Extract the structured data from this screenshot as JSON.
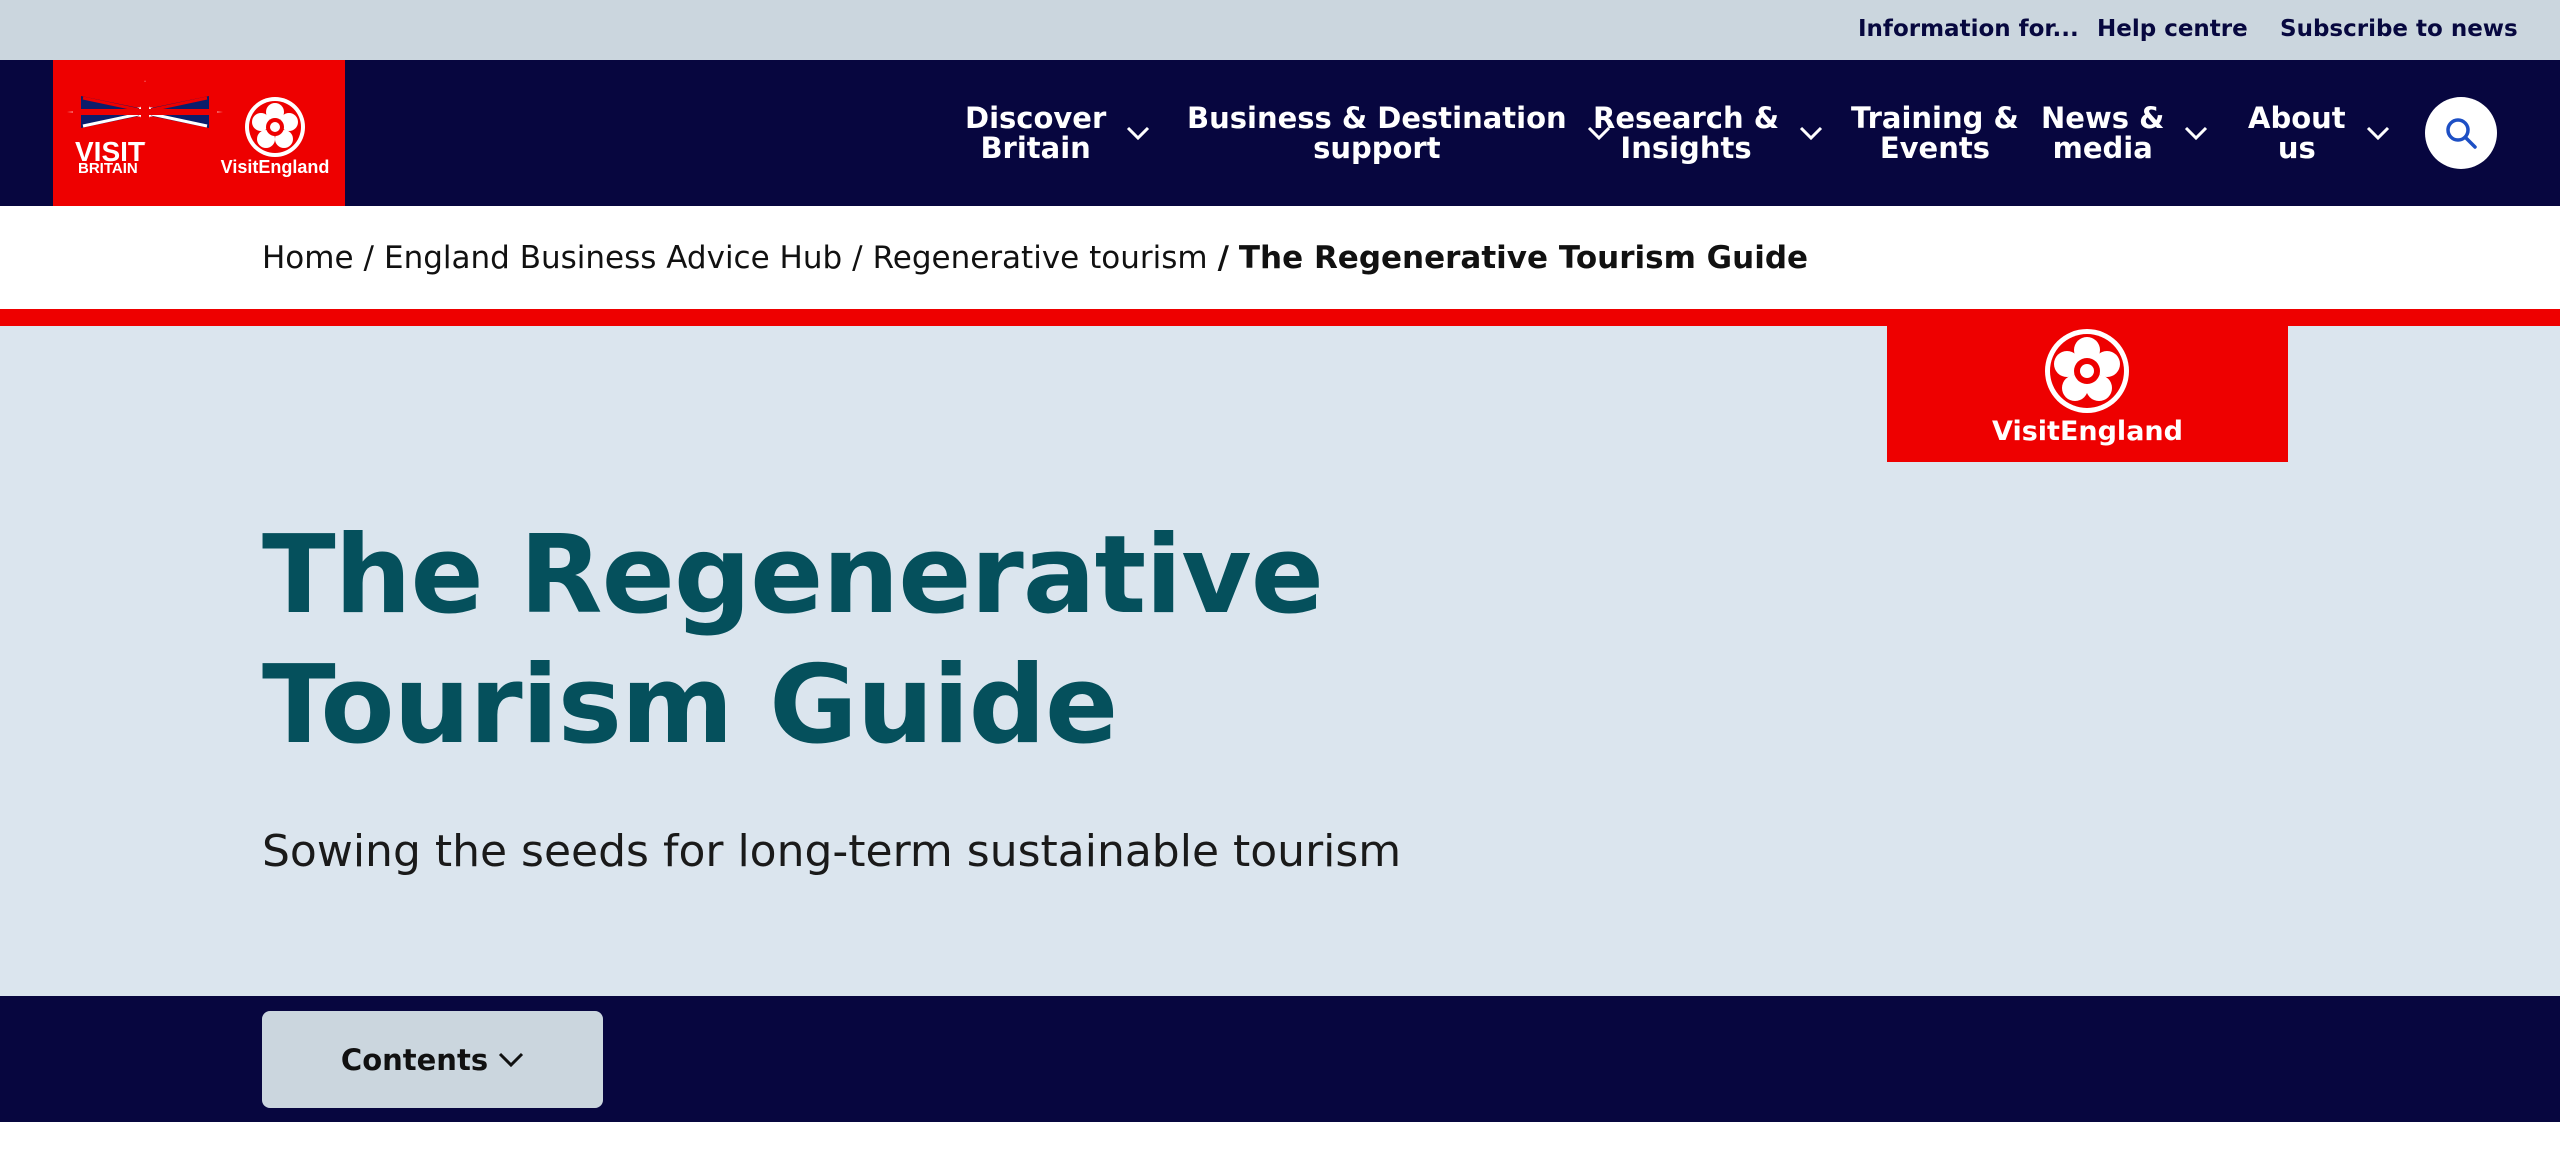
{
  "utility_links": [
    {
      "label": "Information for..."
    },
    {
      "label": "Help centre"
    },
    {
      "label": "Subscribe to news"
    }
  ],
  "logo": {
    "visit_label": "VISIT",
    "britain_label": "BRITAIN",
    "visitengland_label": "VisitEngland"
  },
  "nav_items": [
    {
      "label": "Discover\nBritain"
    },
    {
      "label": "Business & Destination\nsupport"
    },
    {
      "label": "Research &\nInsights"
    },
    {
      "label": "Training &\nEvents"
    },
    {
      "label": "News &\nmedia"
    },
    {
      "label": "About\nus"
    }
  ],
  "icons": {
    "search": "search-icon",
    "chevron": "chevron-down-icon",
    "union_flag": "union-flag-icon",
    "tudor_rose": "tudor-rose-icon"
  },
  "breadcrumb": {
    "items": [
      "Home",
      "England Business Advice Hub",
      "Regenerative tourism"
    ],
    "separator": "/",
    "current": "The Regenerative Tourism Guide"
  },
  "hero": {
    "badge_label": "VisitEngland",
    "title": "The Regenerative Tourism Guide",
    "subtitle": "Sowing the seeds for long-term sustainable tourism"
  },
  "contents": {
    "button_label": "Contents"
  },
  "colors": {
    "utility_bg": "#cbd6de",
    "navy": "#07063f",
    "brand_red": "#ee0000",
    "hero_bg": "#dbe5ee",
    "title_teal": "#05505c",
    "search_icon": "#1d4fc4"
  }
}
